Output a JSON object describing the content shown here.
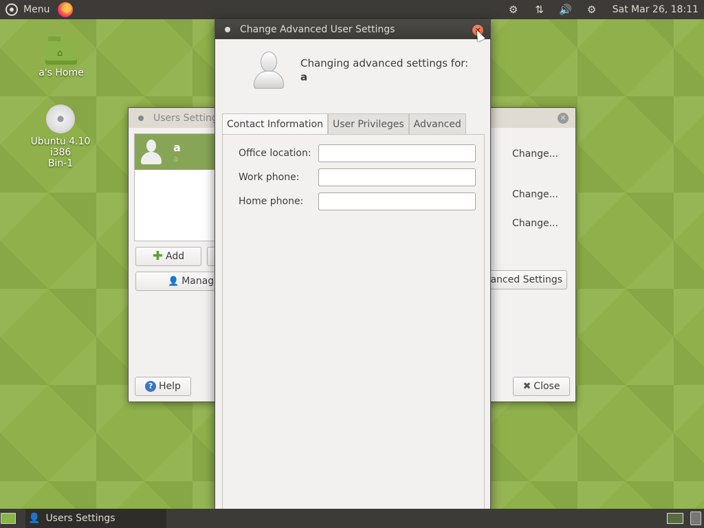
{
  "top_panel": {
    "menu_label": "Menu",
    "clock": "Sat Mar 26, 18:11",
    "tray_icons": [
      "network-wired-icon",
      "transfer-icon",
      "volume-icon",
      "settings-icon"
    ]
  },
  "desktop": {
    "icons": [
      {
        "label": "a's Home",
        "icon": "home-folder-icon"
      },
      {
        "label_line1": "Ubuntu 4.10 i386",
        "label_line2": "Bin-1",
        "icon": "cd-disc-icon"
      }
    ]
  },
  "users_window": {
    "title": "Users Settings",
    "selected_user": {
      "name": "a",
      "subtitle": "a"
    },
    "add_button": "Add",
    "manage_button": "Manage",
    "change_links": [
      "Change...",
      "Change...",
      "Change..."
    ],
    "advanced_button": "vanced Settings",
    "help_button": "Help",
    "close_button": "Close"
  },
  "adv_dialog": {
    "title": "Change Advanced User Settings",
    "heading": "Changing advanced settings for:",
    "username": "a",
    "tabs": [
      "Contact Information",
      "User Privileges",
      "Advanced"
    ],
    "active_tab": "Contact Information",
    "fields": [
      {
        "label": "Office location:",
        "value": ""
      },
      {
        "label": "Work phone:",
        "value": ""
      },
      {
        "label": "Home phone:",
        "value": ""
      }
    ]
  },
  "bottom_panel": {
    "task_label": "Users Settings"
  },
  "colors": {
    "panel": "#3c3b37",
    "selection": "#87a556",
    "close_active": "#e05a2c",
    "desktop": "#8fb04a"
  }
}
